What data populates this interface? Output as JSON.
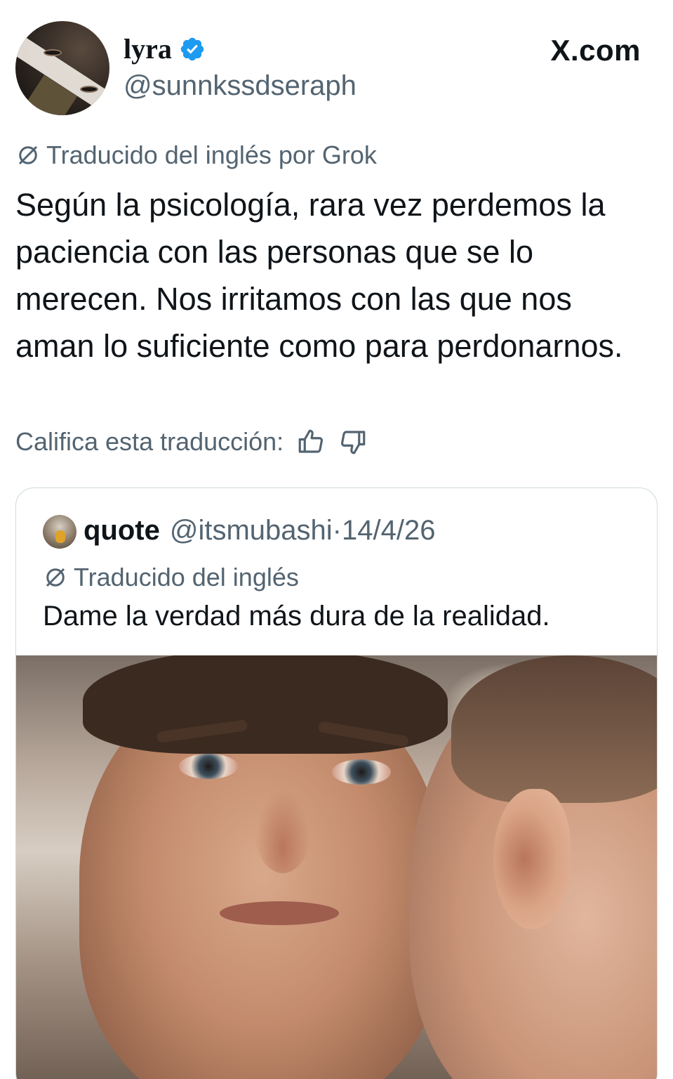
{
  "tweet": {
    "display_name": "lyra",
    "handle": "@sunnkssdseraph",
    "site_label": "X.com",
    "translation_note": "Traducido del inglés por Grok",
    "text": "Según la psicología, rara vez perdemos la paciencia con las personas que se lo merecen. Nos irritamos con las que nos aman lo suficiente como para perdonarnos.",
    "rate_prompt": "Califica esta traducción:",
    "icons": {
      "verified": "verified-badge-icon",
      "translation": "translate-icon",
      "thumbs_up": "thumbs-up-icon",
      "thumbs_down": "thumbs-down-icon"
    }
  },
  "quote": {
    "display_name": "quote",
    "handle": "@itsmubashi",
    "date": "·14/4/26",
    "translation_note": "Traducido del inglés",
    "text": "Dame la verdad más dura de la realidad."
  },
  "colors": {
    "text_primary": "#0f1419",
    "text_secondary": "#536471",
    "verified_blue": "#1d9bf0",
    "border": "#cfd9de"
  }
}
